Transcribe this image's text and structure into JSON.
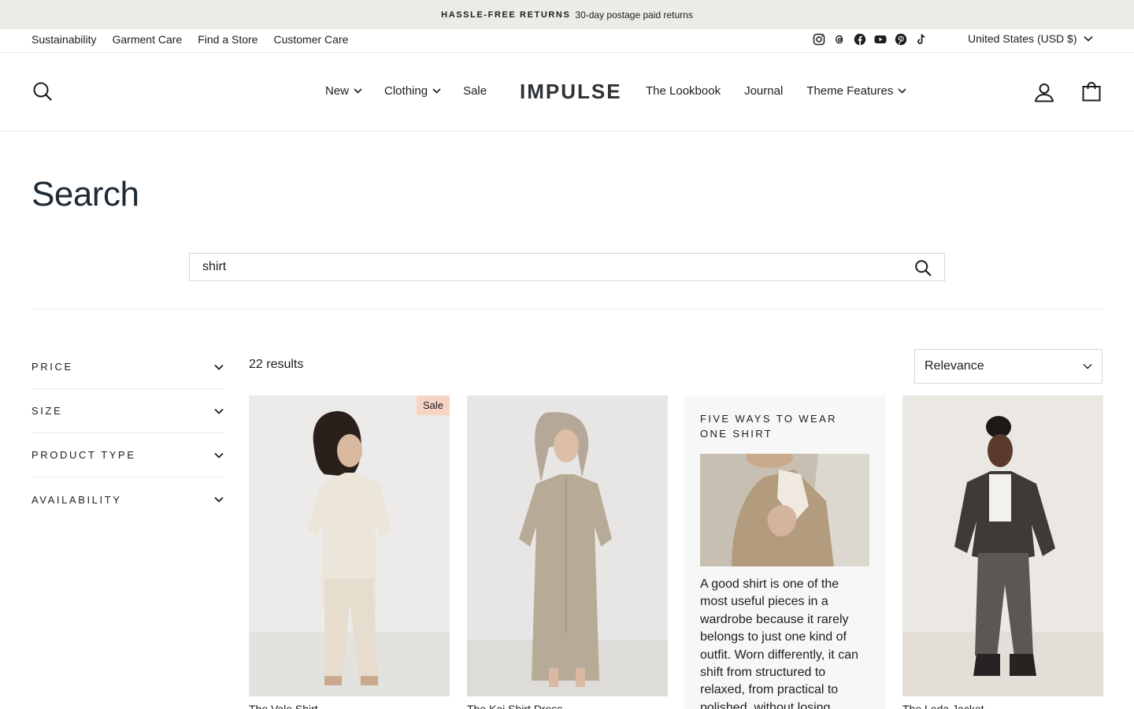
{
  "announcement": {
    "title": "HASSLE-FREE RETURNS",
    "text": "30-day postage paid returns"
  },
  "utility": {
    "links": [
      "Sustainability",
      "Garment Care",
      "Find a Store",
      "Customer Care"
    ],
    "socials": [
      "instagram-icon",
      "threads-icon",
      "facebook-icon",
      "youtube-icon",
      "pinterest-icon",
      "tiktok-icon"
    ],
    "currency": "United States (USD $)"
  },
  "header": {
    "logo": "IMPULSE",
    "nav_left": [
      {
        "label": "New",
        "dropdown": true
      },
      {
        "label": "Clothing",
        "dropdown": true
      },
      {
        "label": "Sale",
        "dropdown": false
      }
    ],
    "nav_right": [
      {
        "label": "The Lookbook",
        "dropdown": false
      },
      {
        "label": "Journal",
        "dropdown": false
      },
      {
        "label": "Theme Features",
        "dropdown": true
      }
    ]
  },
  "page": {
    "title": "Search"
  },
  "search": {
    "value": "shirt"
  },
  "filters": [
    "PRICE",
    "SIZE",
    "PRODUCT TYPE",
    "AVAILABILITY"
  ],
  "results": {
    "count_label": "22 results",
    "sort": "Relevance"
  },
  "products": [
    {
      "name": "The Vale Shirt",
      "badge": "Sale"
    },
    {
      "name": "The Kai Shirt Dress",
      "badge": ""
    },
    {
      "name": "The Leda Jacket",
      "badge": ""
    }
  ],
  "article": {
    "title": "FIVE WAYS TO WEAR ONE SHIRT",
    "excerpt": "A good shirt is one of the most useful pieces in a wardrobe because it rarely belongs to just one kind of outfit. Worn differently, it can shift from structured to relaxed, from practical to polished, without losing"
  },
  "colors": {
    "announcement_bg": "#ecebe8",
    "sale_badge": "#f7d3c4",
    "title": "#1f2a33",
    "border": "#e8e8e1"
  }
}
